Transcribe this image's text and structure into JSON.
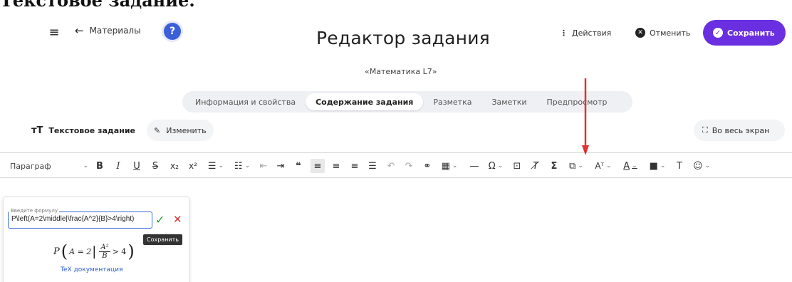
{
  "page_caption": "Текстовое задание.",
  "header": {
    "back_label": "Материалы",
    "help_icon": "?",
    "title": "Редактор задания",
    "subtitle": "«Математика L7»",
    "actions_label": "Действия",
    "cancel_label": "Отменить",
    "save_label": "Сохранить",
    "accent_color": "#6a2fe0"
  },
  "tabs": [
    {
      "label": "Информация и свойства",
      "active": false
    },
    {
      "label": "Содержание задания",
      "active": true
    },
    {
      "label": "Разметка",
      "active": false
    },
    {
      "label": "Заметки",
      "active": false
    },
    {
      "label": "Предпросмотр",
      "active": false
    }
  ],
  "task_bar": {
    "type_label": "Текстовое задание",
    "edit_label": "Изменить",
    "fullscreen_label": "Во весь экран"
  },
  "toolbar": {
    "paragraph_label": "Параграф",
    "buttons": [
      "bold",
      "italic",
      "underline",
      "strikethrough",
      "subscript",
      "superscript",
      "numbered-list",
      "bullet-list",
      "outdent",
      "indent",
      "blockquote",
      "align-left",
      "align-center",
      "align-right",
      "align-justify",
      "undo",
      "redo",
      "link",
      "table",
      "horizontal-line",
      "special-char",
      "embed",
      "clear-format",
      "formula",
      "source",
      "font-size",
      "font-color",
      "background-color",
      "text-transform",
      "emoji"
    ]
  },
  "formula": {
    "field_label": "Введите формулу",
    "input_value": "P\\left(A=2\\middle|\\frac{A^2}{B}>4\\right)",
    "save_tooltip": "Сохранить",
    "preview_p": "P",
    "preview_left": "A = 2",
    "preview_num": "A²",
    "preview_den": "B",
    "preview_right": "> 4",
    "tex_link": "TeX документация"
  }
}
